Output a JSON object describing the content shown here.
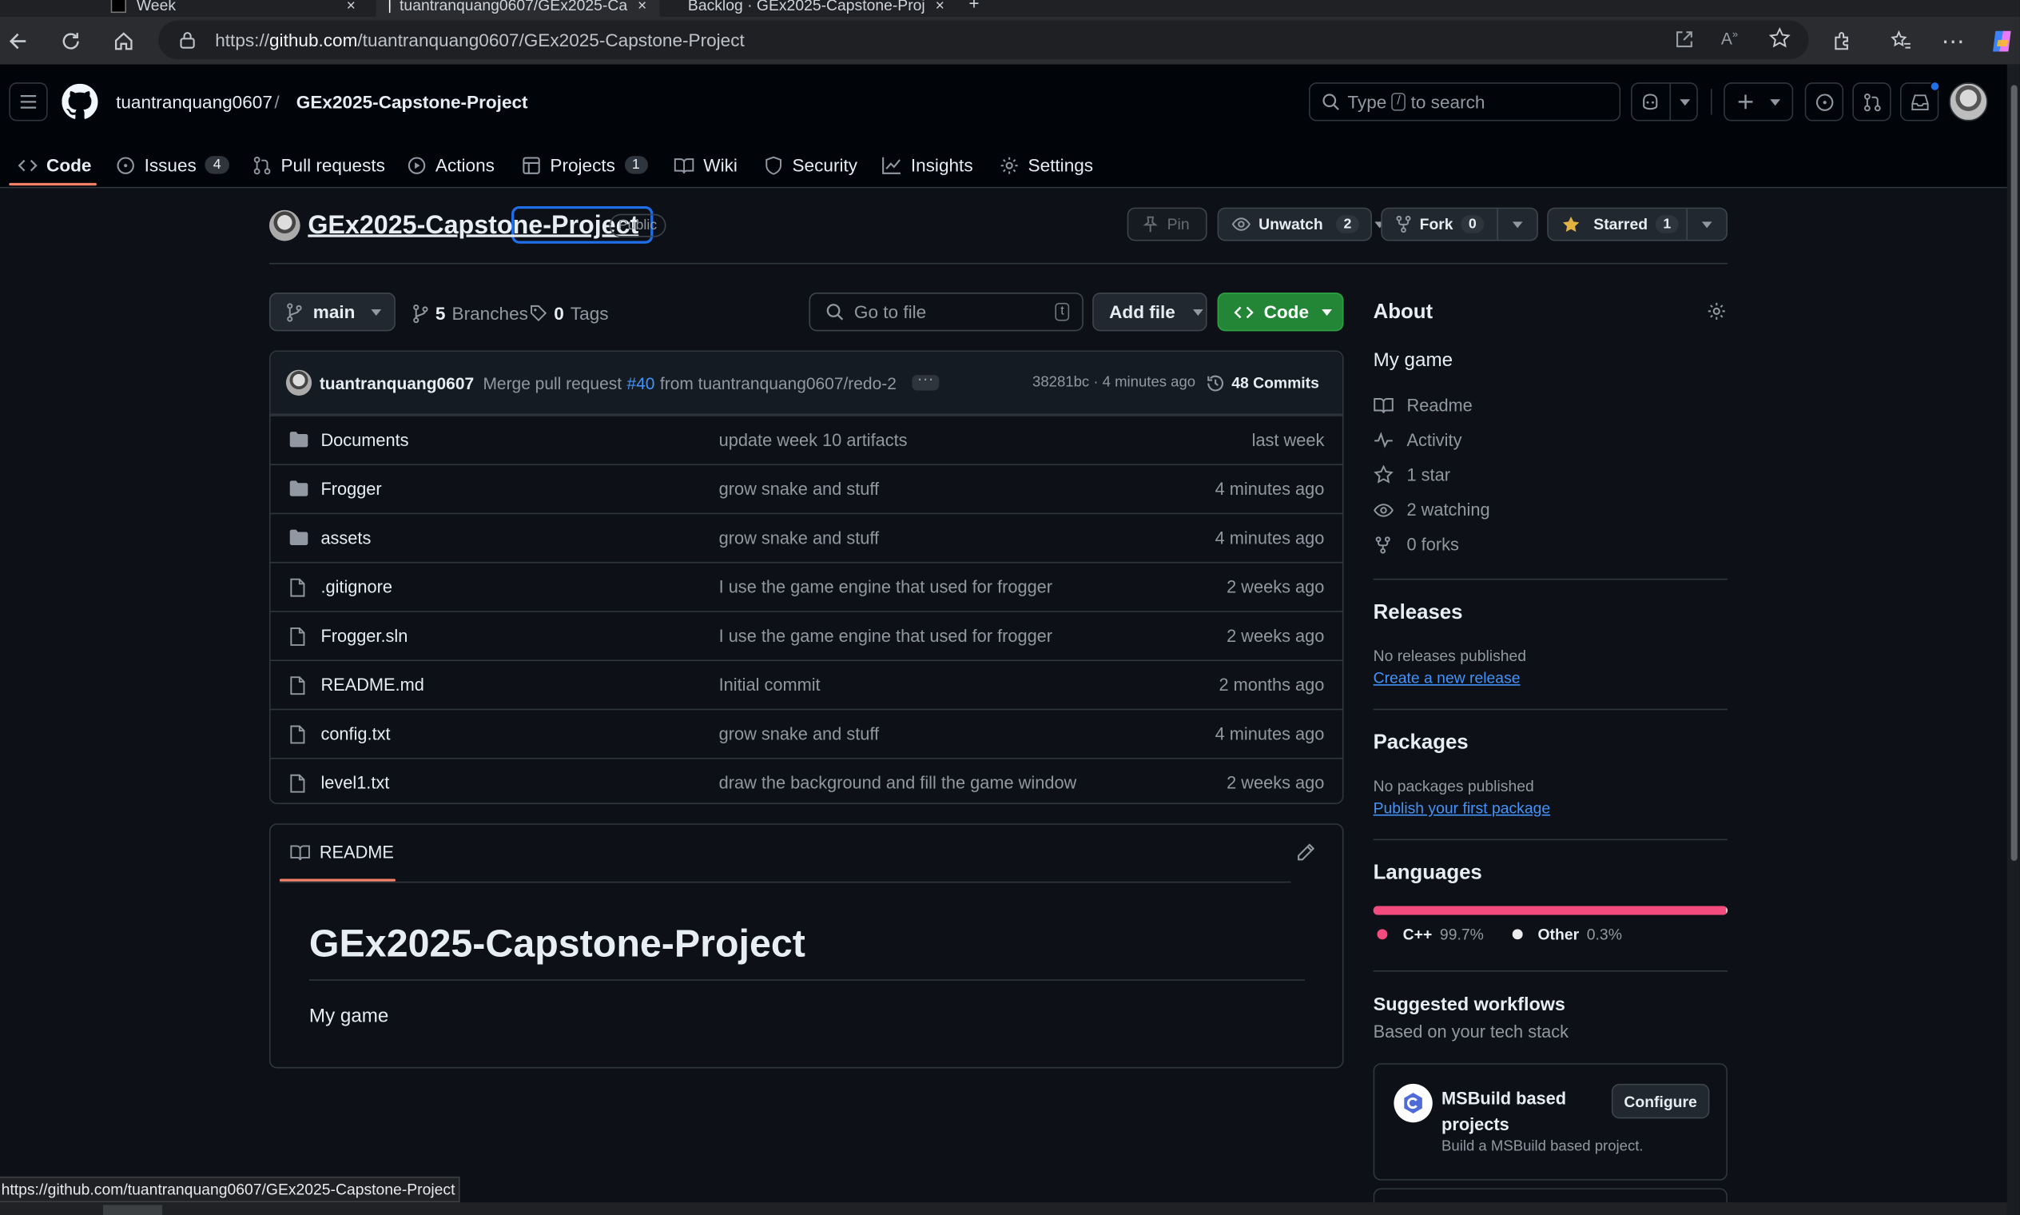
{
  "browser": {
    "tabs": [
      {
        "label": "Week "
      },
      {
        "label": "tuantranquang0607/GEx2025-Ca"
      },
      {
        "label": "Backlog · GEx2025-Capstone-Proj"
      }
    ],
    "url_prefix": "https://",
    "url_host": "github.com",
    "url_path": "/tuantranquang0607/GEx2025-Capstone-Project",
    "status_url": "https://github.com/tuantranquang0607/GEx2025-Capstone-Project"
  },
  "header": {
    "owner": "tuantranquang0607",
    "separator": "/",
    "repo": "GEx2025-Capstone-Project",
    "search_type": "Type",
    "search_key": "/",
    "search_rest": "to search"
  },
  "nav": {
    "code": "Code",
    "issues": "Issues",
    "issues_count": "4",
    "pulls": "Pull requests",
    "actions": "Actions",
    "projects": "Projects",
    "projects_count": "1",
    "wiki": "Wiki",
    "security": "Security",
    "insights": "Insights",
    "settings": "Settings"
  },
  "repo": {
    "name": "GEx2025-Capstone-Project",
    "visibility": "Public",
    "pin": "Pin",
    "unwatch": "Unwatch",
    "watch_count": "2",
    "fork": "Fork",
    "fork_count": "0",
    "starred": "Starred",
    "star_count": "1"
  },
  "browser_bar": {
    "branch": "main",
    "branches_count": "5",
    "branches_label": "Branches",
    "tags_count": "0",
    "tags_label": "Tags",
    "goto_placeholder": "Go to file",
    "goto_key": "t",
    "add_file": "Add file",
    "code_button": "Code"
  },
  "commit": {
    "author": "tuantranquang0607",
    "msg_prefix": "Merge pull request",
    "pr": "#40",
    "msg_suffix": "from tuantranquang0607/redo-2",
    "hash_time": "38281bc · 4 minutes ago",
    "commits": "48 Commits"
  },
  "files": [
    {
      "name": "Documents",
      "type": "dir",
      "message": "update week 10 artifacts",
      "time": "last week"
    },
    {
      "name": "Frogger",
      "type": "dir",
      "message": "grow snake and stuff",
      "time": "4 minutes ago"
    },
    {
      "name": "assets",
      "type": "dir",
      "message": "grow snake and stuff",
      "time": "4 minutes ago"
    },
    {
      "name": ".gitignore",
      "type": "file",
      "message": "I use the game engine that used for frogger",
      "time": "2 weeks ago"
    },
    {
      "name": "Frogger.sln",
      "type": "file",
      "message": "I use the game engine that used for frogger",
      "time": "2 weeks ago"
    },
    {
      "name": "README.md",
      "type": "file",
      "message": "Initial commit",
      "time": "2 months ago"
    },
    {
      "name": "config.txt",
      "type": "file",
      "message": "grow snake and stuff",
      "time": "4 minutes ago"
    },
    {
      "name": "level1.txt",
      "type": "file",
      "message": "draw the background and fill the game window",
      "time": "2 weeks ago"
    }
  ],
  "readme": {
    "tab": "README",
    "title": "GEx2025-Capstone-Project",
    "body": "My game"
  },
  "about": {
    "heading": "About",
    "description": "My game",
    "readme": "Readme",
    "activity": "Activity",
    "stars": "1 star",
    "watching": "2 watching",
    "forks": "0 forks"
  },
  "releases": {
    "heading": "Releases",
    "none": "No releases published",
    "create": "Create a new release"
  },
  "packages": {
    "heading": "Packages",
    "none": "No packages published",
    "publish": "Publish your first package"
  },
  "languages": {
    "heading": "Languages",
    "items": [
      {
        "name": "C++",
        "percent": "99.7%",
        "value": 99.7,
        "color": "#f34b7d"
      },
      {
        "name": "Other",
        "percent": "0.3%",
        "value": 0.3,
        "color": "#ededed"
      }
    ]
  },
  "workflows": {
    "heading": "Suggested workflows",
    "subheading": "Based on your tech stack",
    "card_title_1": "MSBuild based",
    "card_title_2": "projects",
    "card_desc": "Build a MSBuild based project.",
    "configure": "Configure"
  },
  "colors": {
    "accent_green": "#238636",
    "link": "#4493f8",
    "underline": "#f78166",
    "star": "#e3b341"
  }
}
